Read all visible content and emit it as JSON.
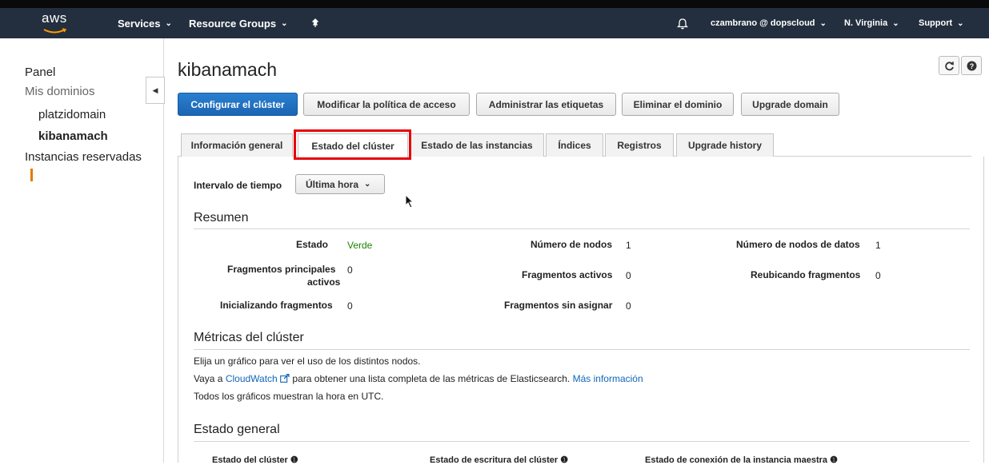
{
  "nav": {
    "logo": "aws",
    "services": "Services",
    "resource_groups": "Resource Groups",
    "pin_icon": "pin-icon",
    "bell_icon": "bell-icon",
    "user": "czambrano @ dopscloud",
    "region": "N. Virginia",
    "support": "Support"
  },
  "sidebar": {
    "panel": "Panel",
    "my_domains": "Mis dominios",
    "domains": [
      "platzidomain",
      "kibanamach"
    ],
    "reserved": "Instancias reservadas"
  },
  "page": {
    "title": "kibanamach"
  },
  "actions": {
    "configure": "Configurar el clúster",
    "modify_policy": "Modificar la política de acceso",
    "manage_tags": "Administrar las etiquetas",
    "delete_domain": "Eliminar el dominio",
    "upgrade_domain": "Upgrade domain"
  },
  "tabs": [
    "Información general",
    "Estado del clúster",
    "Estado de las instancias",
    "Índices",
    "Registros",
    "Upgrade history"
  ],
  "time": {
    "label": "Intervalo de tiempo",
    "value": "Última hora"
  },
  "summary": {
    "title": "Resumen",
    "estado_label": "Estado",
    "estado_value": "Verde",
    "num_nodos_label": "Número de nodos",
    "num_nodos_value": "1",
    "num_nodos_datos_label": "Número de nodos de datos",
    "num_nodos_datos_value": "1",
    "frag_princ_label_1": "Fragmentos principales",
    "frag_princ_label_2": "activos",
    "frag_princ_value": "0",
    "frag_activos_label": "Fragmentos activos",
    "frag_activos_value": "0",
    "reubicando_label": "Reubicando fragmentos",
    "reubicando_value": "0",
    "inicializando_label": "Inicializando fragmentos",
    "inicializando_value": "0",
    "sin_asignar_label": "Fragmentos sin asignar",
    "sin_asignar_value": "0"
  },
  "metrics": {
    "title": "Métricas del clúster",
    "line1": "Elija un gráfico para ver el uso de los distintos nodos.",
    "line2_prefix": "Vaya a ",
    "line2_link": "CloudWatch",
    "line2_middle": " para obtener una lista completa de las métricas de Elasticsearch. ",
    "line2_more": "Más información",
    "line3": "Todos los gráficos muestran la hora en UTC."
  },
  "general": {
    "title": "Estado general",
    "col1": "Estado del clúster",
    "col2": "Estado de escritura del clúster",
    "col3": "Estado de conexión de la instancia maestra"
  },
  "colors": {
    "navbar": "#232f3e",
    "primary": "#1b65b3",
    "green": "#1d8102",
    "highlight": "#e8000b",
    "link": "#1066b8"
  }
}
